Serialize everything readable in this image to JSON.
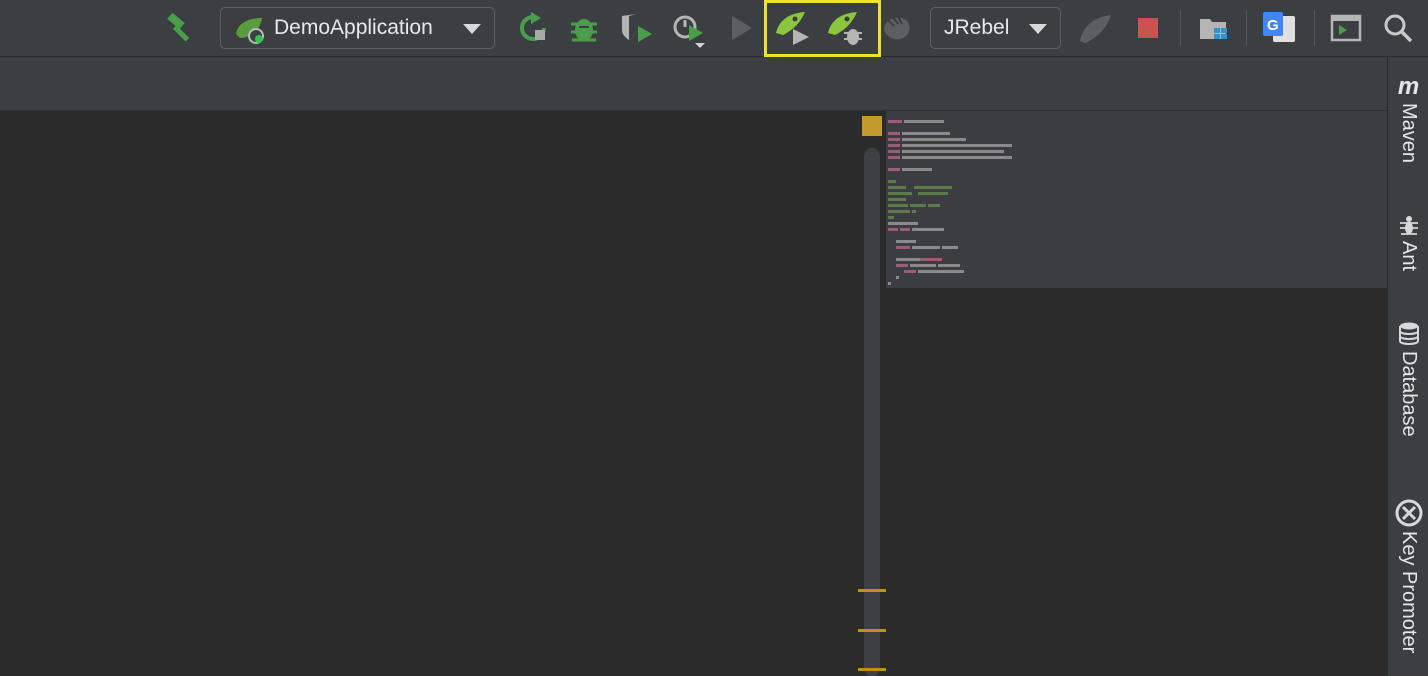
{
  "toolbar": {
    "run_config_label": "DemoApplication",
    "jrebel_label": "JRebel",
    "icons": [
      "hammer-icon",
      "spring-boot-icon",
      "rerun-icon",
      "debug-icon",
      "coverage-icon",
      "profiler-icon",
      "run-icon",
      "jrebel-run-icon",
      "jrebel-debug-icon",
      "attach-icon",
      "jrebel-logo-icon",
      "stop-icon",
      "project-structure-icon",
      "translate-icon",
      "terminal-icon",
      "search-icon"
    ]
  },
  "right_panel": {
    "tabs": [
      {
        "label": "Maven",
        "icon": "maven-icon"
      },
      {
        "label": "Ant",
        "icon": "ant-icon"
      },
      {
        "label": "Database",
        "icon": "database-icon"
      },
      {
        "label": "Key Promoter",
        "icon": "key-promoter-icon"
      }
    ]
  },
  "translate": {
    "glyph": "G"
  },
  "maven": {
    "glyph": "m"
  },
  "colors": {
    "toolbar_bg": "#3c3f41",
    "editor_bg": "#2b2b2b",
    "accent_green": "#4a9e4a",
    "stop_red": "#c75450",
    "highlight_yellow": "#f1e12d"
  }
}
